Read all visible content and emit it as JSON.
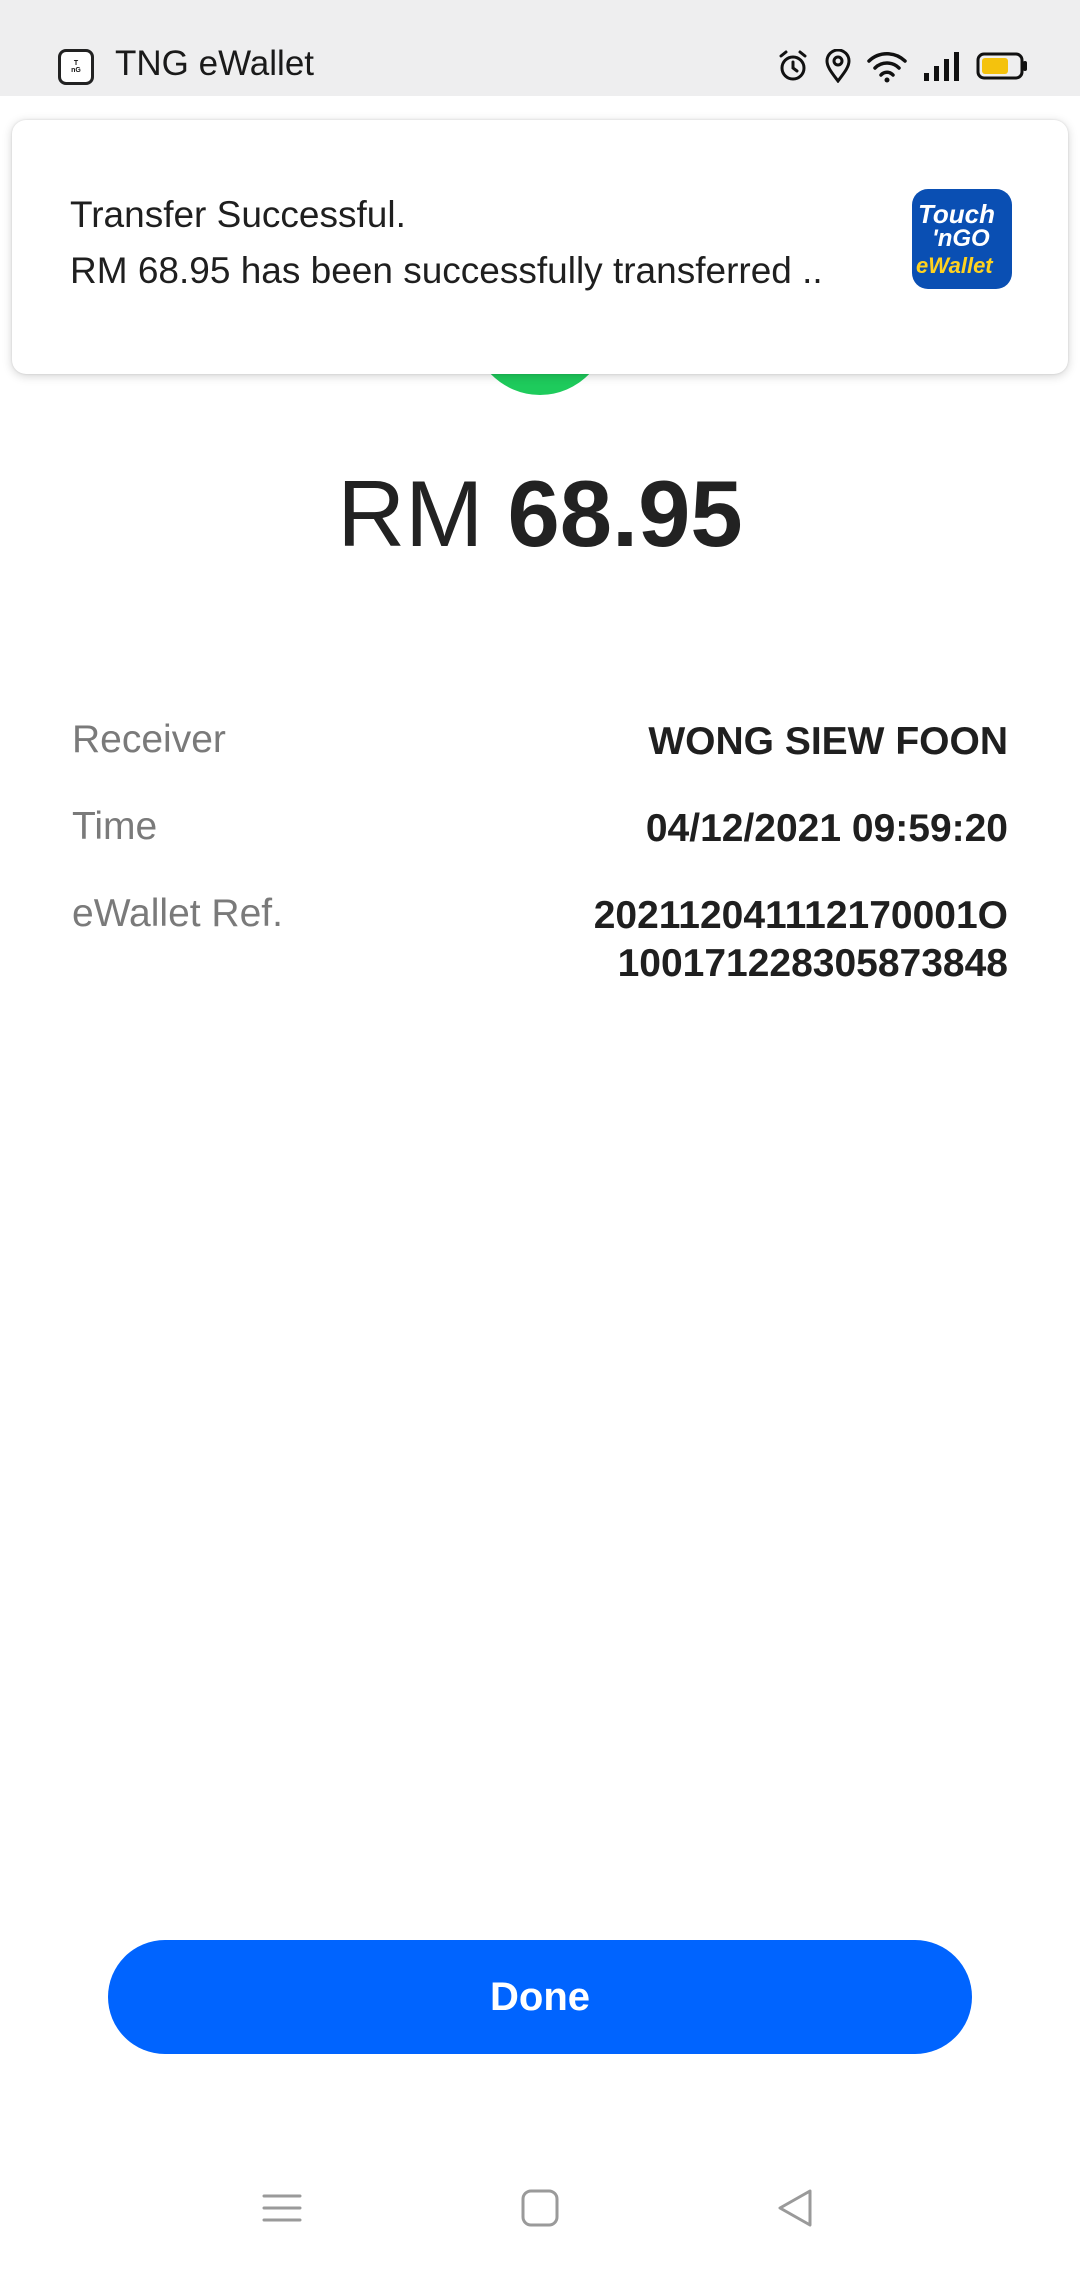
{
  "status_bar": {
    "app_name": "TNG eWallet",
    "mini_icon_text": "Touch 'nGO eWallet",
    "icons": [
      "alarm-icon",
      "location-icon",
      "wifi-icon",
      "signal-icon",
      "battery-icon"
    ]
  },
  "notification": {
    "title": "Transfer Successful.",
    "body": "RM 68.95 has been successfully transferred ..",
    "logo": {
      "line1": "Touch",
      "line2": "'nGO",
      "line3": "eWallet"
    }
  },
  "transaction": {
    "currency": "RM",
    "amount": "68.95",
    "rows": [
      {
        "label": "Receiver",
        "value": "WONG SIEW FOON"
      },
      {
        "label": "Time",
        "value": "04/12/2021 09:59:20"
      },
      {
        "label": "eWallet Ref.",
        "value_line1": "202112041112170001O",
        "value_line2": "100171228305873848"
      }
    ]
  },
  "done_button": {
    "label": "Done"
  },
  "colors": {
    "accent": "#0064ff",
    "success": "#1ecb5c",
    "logo_blue": "#0a4fb3",
    "logo_yellow": "#ffd21f"
  },
  "nav_bar": {
    "icons": [
      "menu-icon",
      "home-icon",
      "back-icon"
    ]
  }
}
